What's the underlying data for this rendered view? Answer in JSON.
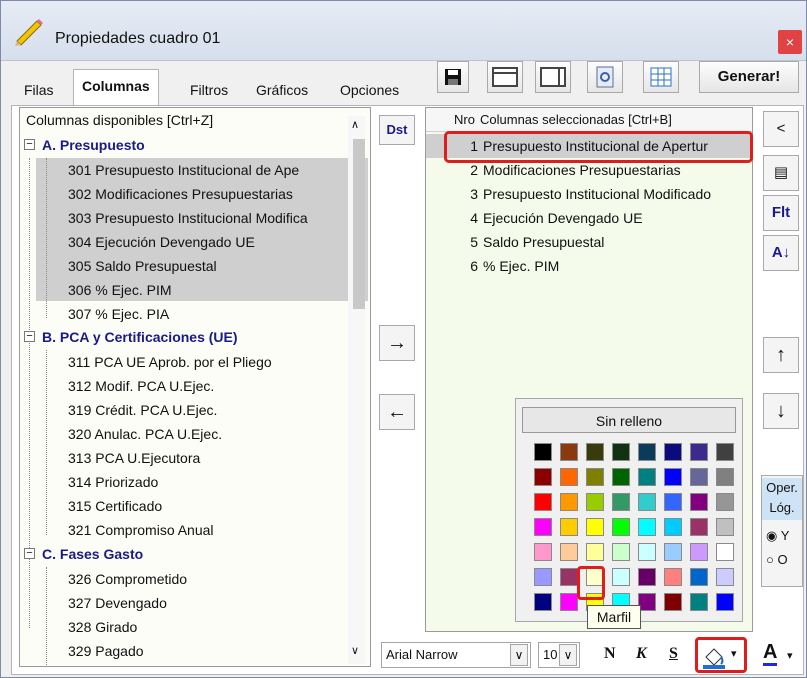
{
  "window": {
    "title": "Propiedades cuadro 01",
    "close": "×"
  },
  "tabs": [
    "Filas",
    "Columnas",
    "Filtros",
    "Gráficos",
    "Opciones"
  ],
  "toolbar": {
    "generar": "Generar!"
  },
  "left_panel": {
    "header": "Columnas disponibles    [Ctrl+Z]",
    "groups": [
      {
        "label": "A. Presupuesto",
        "items": [
          "301 Presupuesto Institucional de Ape",
          "302 Modificaciones Presupuestarias",
          "303 Presupuesto Institucional Modifica",
          "304 Ejecución Devengado UE",
          "305 Saldo Presupuestal",
          "306 % Ejec. PIM",
          "307 % Ejec. PIA"
        ]
      },
      {
        "label": "B. PCA y Certificaciones (UE)",
        "items": [
          "311 PCA UE Aprob. por el Pliego",
          "312 Modif. PCA U.Ejec.",
          "319 Crédit. PCA U.Ejec.",
          "320 Anulac. PCA U.Ejec.",
          "313 PCA U.Ejecutora",
          "314 Priorizado",
          "315 Certificado",
          "321 Compromiso Anual"
        ]
      },
      {
        "label": "C. Fases Gasto",
        "items": [
          "326 Comprometido",
          "327 Devengado",
          "328 Girado",
          "329 Pagado"
        ]
      }
    ]
  },
  "dst_label": "Dst",
  "right_panel": {
    "header_nro": "Nro",
    "header_label": "Columnas seleccionadas    [Ctrl+B]",
    "rows": [
      {
        "n": "1",
        "label": "Presupuesto Institucional de Apertur"
      },
      {
        "n": "2",
        "label": "Modificaciones Presupuestarias"
      },
      {
        "n": "3",
        "label": "Presupuesto Institucional Modificado"
      },
      {
        "n": "4",
        "label": "Ejecución Devengado UE"
      },
      {
        "n": "5",
        "label": "Saldo Presupuestal"
      },
      {
        "n": "6",
        "label": "% Ejec. PIM"
      }
    ]
  },
  "side": {
    "flt": "Flt"
  },
  "oper": {
    "title": "Oper. Lóg.",
    "opt_y": "Y",
    "opt_o": "O"
  },
  "palette": {
    "label": "Sin relleno",
    "tooltip": "Marfil",
    "colors": [
      [
        "#000000",
        "#8b3a0f",
        "#3a3a0d",
        "#113311",
        "#0b3b5a",
        "#0b0b80",
        "#3c2a8c",
        "#404040"
      ],
      [
        "#8b0000",
        "#ff6600",
        "#808000",
        "#006400",
        "#008080",
        "#0000ff",
        "#666699",
        "#808080"
      ],
      [
        "#ff0000",
        "#ff9900",
        "#99cc00",
        "#339966",
        "#33cccc",
        "#3366ff",
        "#800080",
        "#969696"
      ],
      [
        "#ff00ff",
        "#ffcc00",
        "#ffff00",
        "#00ff00",
        "#00ffff",
        "#00ccff",
        "#993366",
        "#c0c0c0"
      ],
      [
        "#ff99cc",
        "#ffcc99",
        "#ffff99",
        "#ccffcc",
        "#ccffff",
        "#99ccff",
        "#cc99ff",
        "#ffffff"
      ],
      [
        "#9999ff",
        "#993366",
        "#ffffcc",
        "#ccffff",
        "#660066",
        "#ff8080",
        "#0066cc",
        "#ccccff"
      ],
      [
        "#000080",
        "#ff00ff",
        "#ffff00",
        "#00ffff",
        "#800080",
        "#800000",
        "#008080",
        "#0000ff"
      ]
    ]
  },
  "format_bar": {
    "font": "Arial Narrow",
    "size": "10",
    "bold": "N",
    "italic": "K",
    "strike": "S",
    "font_color_letter": "A"
  }
}
